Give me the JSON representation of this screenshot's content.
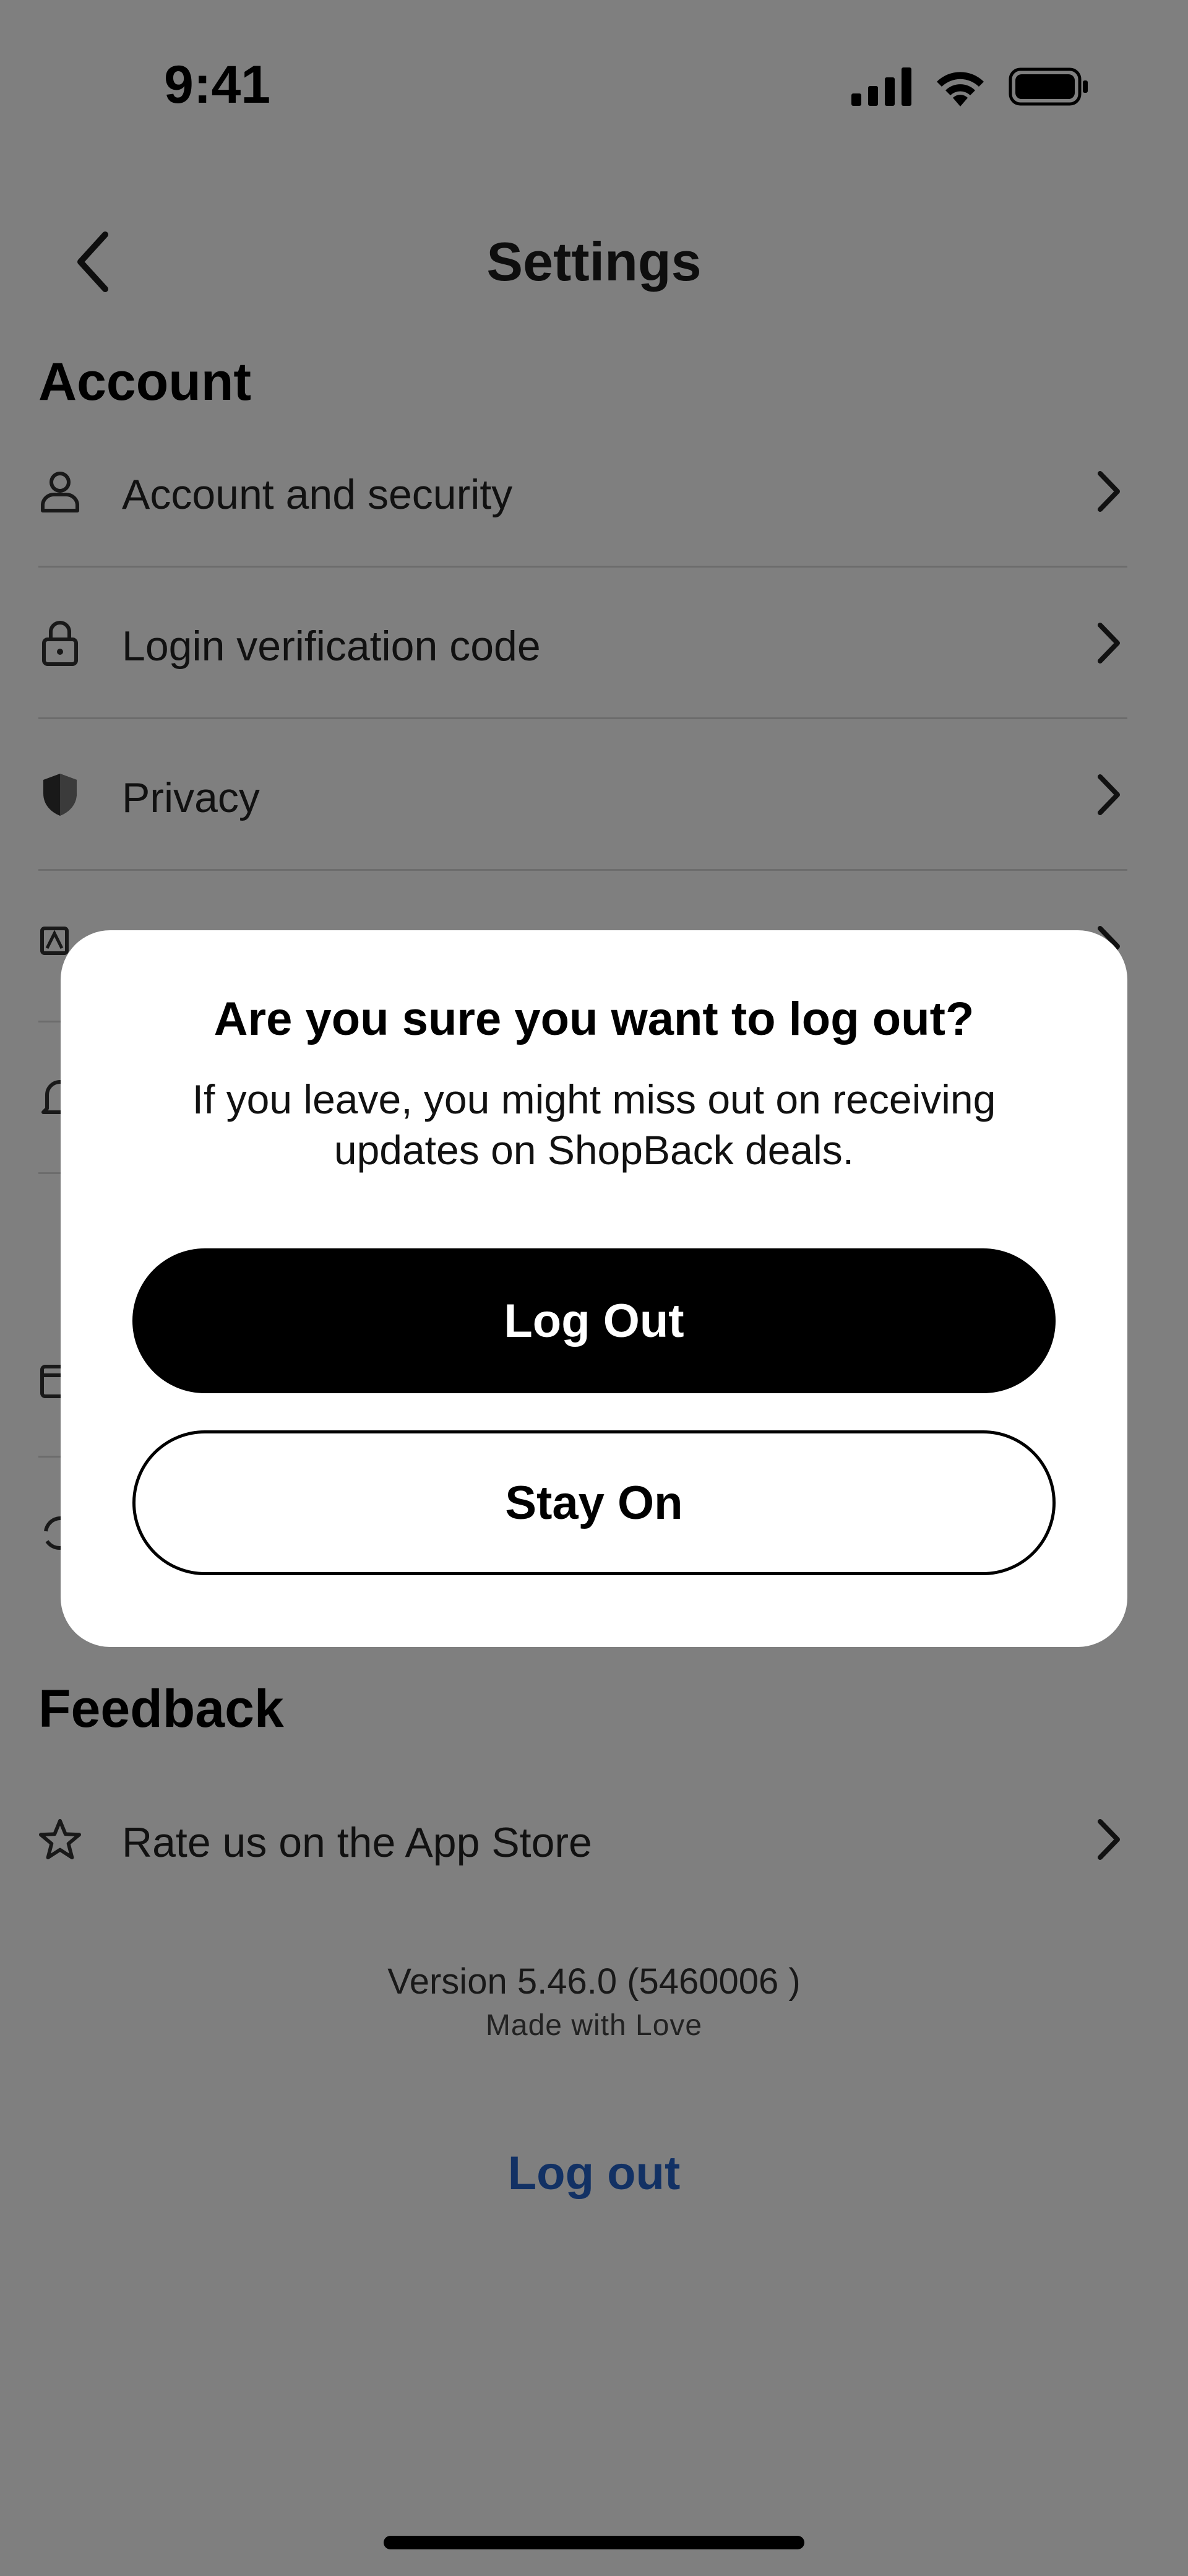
{
  "status_bar": {
    "time": "9:41",
    "icons": [
      "cellular-signal-icon",
      "wifi-icon",
      "battery-icon"
    ]
  },
  "nav": {
    "title": "Settings",
    "back_icon": "chevron-left-icon"
  },
  "sections": {
    "account": {
      "title": "Account",
      "items": [
        {
          "label": "Account and security",
          "icon": "person-icon"
        },
        {
          "label": "Login verification code",
          "icon": "lock-icon"
        },
        {
          "label": "Privacy",
          "icon": "shield-icon"
        }
      ]
    },
    "feedback": {
      "title": "Feedback",
      "items": [
        {
          "label": "Rate us on the App Store",
          "icon": "star-icon"
        }
      ]
    }
  },
  "footer": {
    "version": "Version 5.46.0 (5460006 )",
    "made_with": "Made with Love",
    "logout_link": "Log out"
  },
  "modal": {
    "title": "Are you sure you want to log out?",
    "body": "If you leave, you might miss out on receiving updates on ShopBack deals.",
    "primary_button": "Log Out",
    "secondary_button": "Stay On"
  },
  "colors": {
    "accent_link": "#2463c8",
    "overlay": "rgba(0,0,0,0.5)",
    "primary_button": "#000000"
  }
}
